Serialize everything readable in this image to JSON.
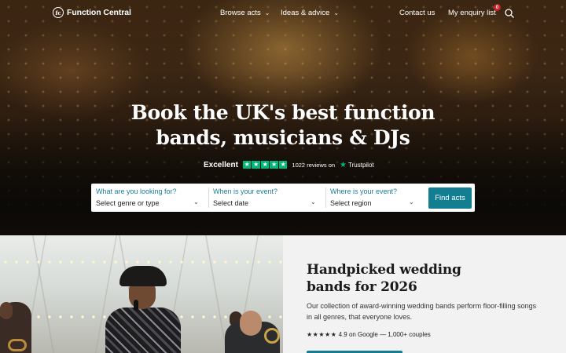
{
  "nav": {
    "brand": "Function Central",
    "brand_mark": "fc",
    "browse": "Browse acts",
    "ideas": "Ideas & advice",
    "contact": "Contact us",
    "enquiry": "My enquiry list",
    "enquiry_count": "0",
    "icons": [
      "function-central-logo",
      "chevron-down-icon",
      "search-icon"
    ]
  },
  "hero": {
    "headline_line1": "Book the UK's best function",
    "headline_line2": "bands, musicians & DJs",
    "trust_label": "Excellent",
    "trust_rating_stars": 5,
    "trust_count": "1022 reviews on",
    "trust_brand": "Trustpilot"
  },
  "search": {
    "genre_label": "What are you looking for?",
    "genre_value": "Select genre or type",
    "date_label": "When is your event?",
    "date_value": "Select date",
    "region_label": "Where is your event?",
    "region_value": "Select region",
    "submit": "Find acts"
  },
  "feature": {
    "title_line1": "Handpicked wedding",
    "title_line2": "bands for 2026",
    "description": "Our collection of award-winning wedding bands perform floor-filling songs in all genres, that everyone loves.",
    "rating_stars": "★★★★★",
    "rating_text": "4.9 on Google — 1,000+ couples"
  },
  "colors": {
    "accent": "#137e92",
    "label": "#1a7f9c",
    "trustpilot": "#00b67a",
    "badge": "#d0202a",
    "panel_bg": "#f2f2f2"
  }
}
